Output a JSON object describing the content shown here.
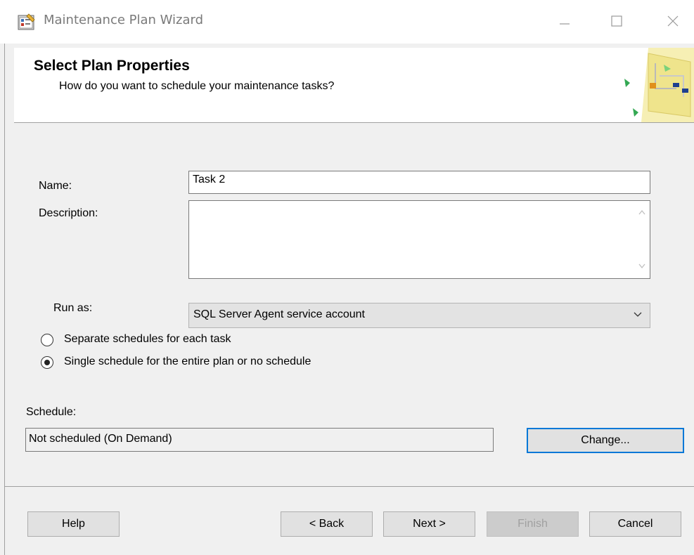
{
  "window": {
    "title": "Maintenance Plan Wizard"
  },
  "header": {
    "title": "Select Plan Properties",
    "subtitle": "How do you want to schedule your maintenance tasks?"
  },
  "form": {
    "name_label": "Name:",
    "name_value": "Task 2",
    "description_label": "Description:",
    "description_value": "",
    "run_as_label": "Run as:",
    "run_as_selected": "SQL Server Agent service account",
    "radio_separate_label": "Separate schedules for each task",
    "radio_single_label": "Single schedule for the entire plan or no schedule",
    "schedule_label": "Schedule:",
    "schedule_value": "Not scheduled (On Demand)",
    "change_button": "Change..."
  },
  "footer": {
    "help": "Help",
    "back": "< Back",
    "next": "Next >",
    "finish": "Finish",
    "cancel": "Cancel"
  },
  "colors": {
    "focus_border": "#0078d7",
    "dialog_bg": "#f0f0f0"
  },
  "icons": [
    "maintenance-plan-app-icon",
    "minimize-icon",
    "maximize-icon",
    "close-icon",
    "wizard-flow-icon",
    "chevron-down-icon",
    "scroll-up-icon",
    "scroll-down-icon"
  ]
}
